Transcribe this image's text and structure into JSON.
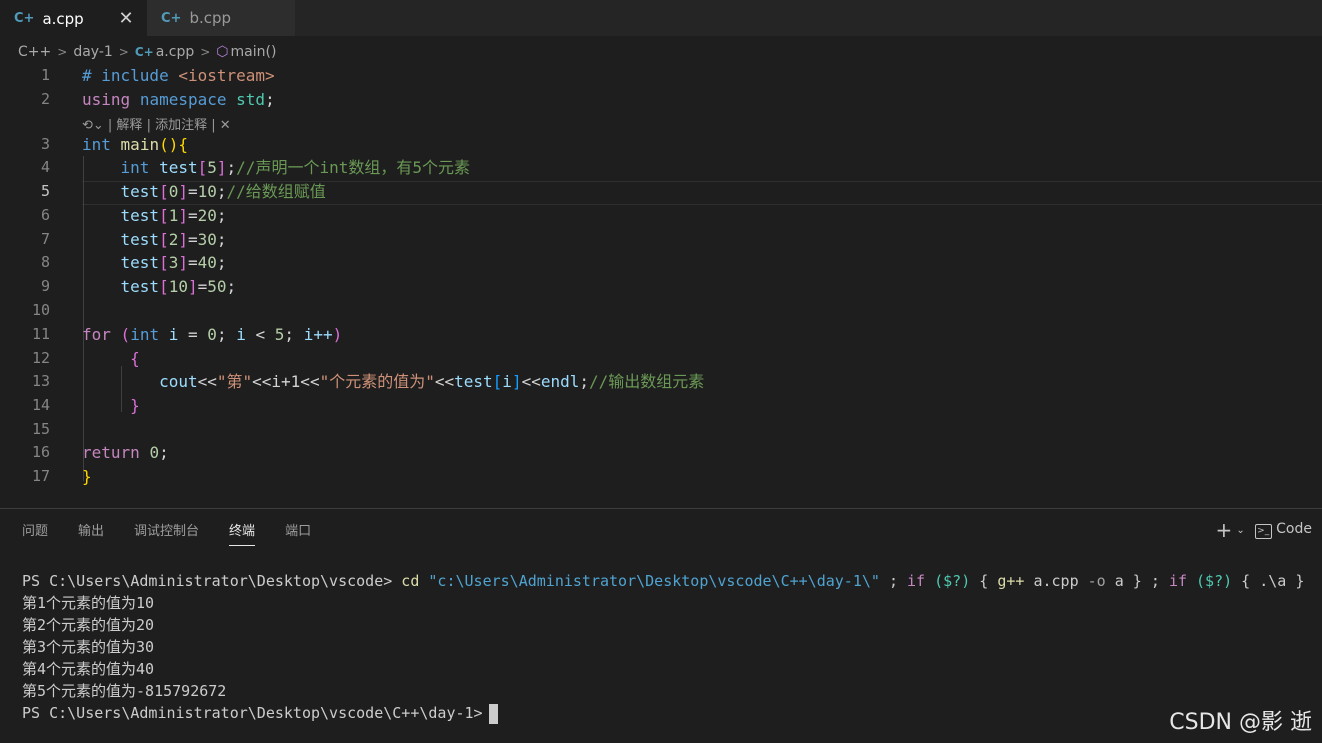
{
  "tabs": [
    {
      "label": "a.cpp",
      "icon": "cpp-file-icon",
      "close": "✕"
    },
    {
      "label": "b.cpp",
      "icon": "cpp-file-icon"
    }
  ],
  "breadcrumb": {
    "lang": "C++",
    "folder": "day-1",
    "file": "a.cpp",
    "symbol": "main()"
  },
  "codelens": "| 解释 | 添加注释 |",
  "editor": {
    "line_numbers": [
      "1",
      "2",
      "3",
      "4",
      "5",
      "6",
      "7",
      "8",
      "9",
      "10",
      "11",
      "12",
      "13",
      "14",
      "15",
      "16",
      "17"
    ],
    "current_line": "5"
  },
  "code": {
    "l1_pre": "# include",
    "l1_inc": "<iostream>",
    "l2_using": "using",
    "l2_ns": "namespace",
    "l2_std": "std",
    "l3_int": "int",
    "l3_main": "main",
    "l4_int": "int",
    "l4_test": "test",
    "l4_num": "5",
    "l4_comment": "//声明一个int数组，有5个元素",
    "l5_test": "test",
    "l5_idx": "0",
    "l5_val": "10",
    "l5_comment": "//给数组赋值",
    "l6_idx": "1",
    "l6_val": "20",
    "l7_idx": "2",
    "l7_val": "30",
    "l8_idx": "3",
    "l8_val": "40",
    "l9_idx": "10",
    "l9_val": "50",
    "l11_for": "for",
    "l11_int": "int",
    "l11_i": "i",
    "l11_zero": "0",
    "l11_five": "5",
    "l11_inc": "i++",
    "l13_cout": "cout",
    "l13_str1": "\"第\"",
    "l13_expr": "<<i+1<<",
    "l13_str2": "\"个元素的值为\"",
    "l13_endl": "endl",
    "l13_comment": "//输出数组元素",
    "l16_return": "return",
    "l16_zero": "0"
  },
  "panel": {
    "tabs": [
      "问题",
      "输出",
      "调试控制台",
      "终端",
      "端口"
    ],
    "active_tab": "终端",
    "new_terminal": "+",
    "profile_label": "Code"
  },
  "terminal": {
    "prompt1": "PS C:\\Users\\Administrator\\Desktop\\vscode>",
    "cmd_cd": "cd",
    "cmd_path": "\"c:\\Users\\Administrator\\Desktop\\vscode\\C++\\day-1\\\"",
    "cmd_rest1": " ; ",
    "cmd_if1": "if",
    "cmd_var1": "($?)",
    "cmd_brace1": " { ",
    "cmd_gpp": "g++",
    "cmd_args": " a.cpp ",
    "cmd_o": "-o",
    "cmd_a": " a } ; ",
    "cmd_if2": "if",
    "cmd_var2": "($?)",
    "cmd_run": " { .\\a }",
    "outputs": [
      "第1个元素的值为10",
      "第2个元素的值为20",
      "第3个元素的值为30",
      "第4个元素的值为40",
      "第5个元素的值为-815792672"
    ],
    "prompt2": "PS C:\\Users\\Administrator\\Desktop\\vscode\\C++\\day-1>"
  },
  "watermark": "CSDN @影 逝"
}
